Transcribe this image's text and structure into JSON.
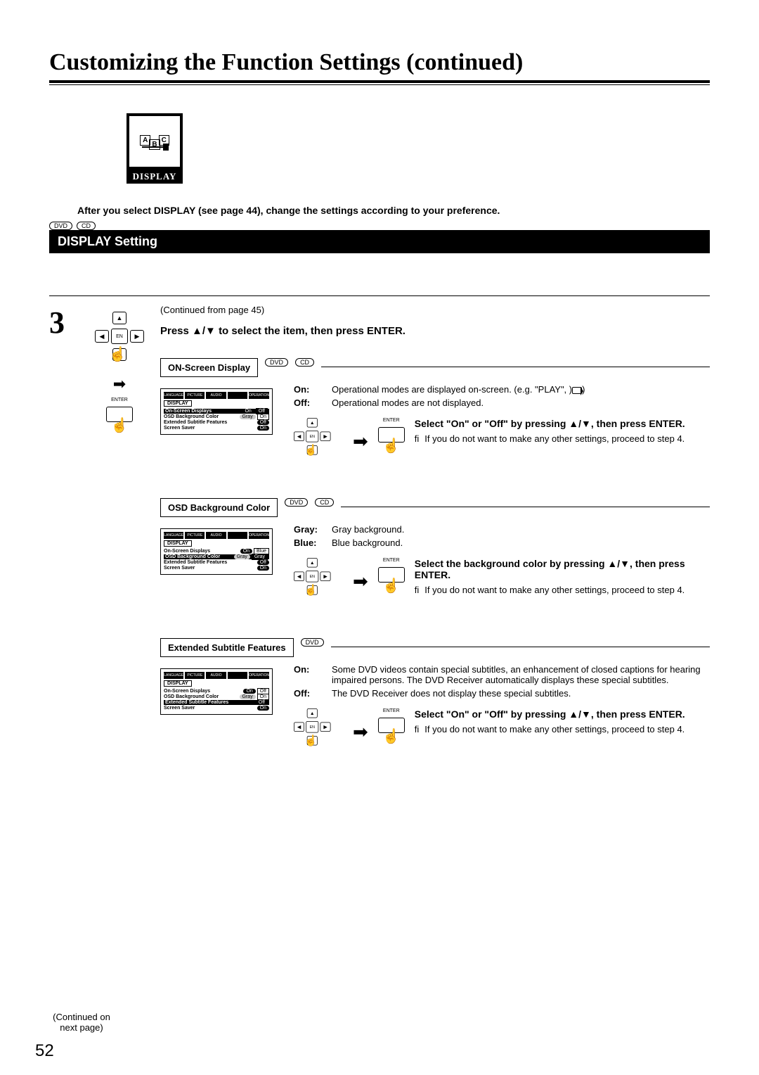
{
  "heading": "Customizing the Function Settings (continued)",
  "display_icon_label": "DISPLAY",
  "intro": "After you select DISPLAY (see page 44), change the settings according to your preference.",
  "disc_dvd": "DVD",
  "disc_cd": "CD",
  "section_bar": "DISPLAY Setting",
  "step_number": "3",
  "continued_from": "(Continued from page 45)",
  "press_instr": "Press ▲/▼ to select the item, then press ENTER.",
  "enter_label": "ENTER",
  "options": {
    "osd": {
      "label": "ON-Screen Display",
      "discs": [
        "DVD",
        "CD"
      ],
      "desc": {
        "on_k": "On:",
        "on_v": "Operational modes are displayed on-screen. (e.g. \"PLAY\",       )",
        "off_k": "Off:",
        "off_v": "Operational modes are not displayed."
      },
      "action_b": "Select \"On\" or \"Off\" by pressing ▲/▼, then press ENTER.",
      "action_note": "If you do not want to make any other settings, proceed to step 4.",
      "preview": {
        "title": "DISPLAY",
        "rows": [
          {
            "lbl": "On-Screen Displays",
            "v1": "On",
            "v2": "Off",
            "hl": true
          },
          {
            "lbl": "OSD Background Color",
            "v1": "Gray",
            "v2": "On"
          },
          {
            "lbl": "Extended Subtitle Features",
            "v1": "Off"
          },
          {
            "lbl": "Screen Saver",
            "v1": "On"
          }
        ]
      }
    },
    "bg": {
      "label": "OSD Background Color",
      "discs": [
        "DVD",
        "CD"
      ],
      "desc": {
        "gray_k": "Gray:",
        "gray_v": "Gray background.",
        "blue_k": "Blue:",
        "blue_v": "Blue background."
      },
      "action_b": "Select the background color by pressing ▲/▼, then press ENTER.",
      "action_note": "If you do not want to make any other settings, proceed to step 4.",
      "preview": {
        "title": "DISPLAY",
        "rows": [
          {
            "lbl": "On-Screen Displays",
            "v1": "On",
            "v2": "Blue"
          },
          {
            "lbl": "OSD Background Color",
            "v1": "Gray",
            "v2": "Gray",
            "hl": true
          },
          {
            "lbl": "Extended Subtitle Features",
            "v1": "Off"
          },
          {
            "lbl": "Screen Saver",
            "v1": "On"
          }
        ]
      }
    },
    "ext": {
      "label": "Extended Subtitle Features",
      "discs": [
        "DVD"
      ],
      "desc": {
        "on_k": "On:",
        "on_v": "Some DVD videos contain special subtitles, an enhancement of closed captions for hearing impaired persons. The DVD Receiver automatically displays these special subtitles.",
        "off_k": "Off:",
        "off_v": "The DVD Receiver does not display these special subtitles."
      },
      "action_b": "Select \"On\" or \"Off\" by pressing ▲/▼, then press ENTER.",
      "action_note": "If you do not want to make any other settings, proceed to step 4.",
      "preview": {
        "title": "DISPLAY",
        "rows": [
          {
            "lbl": "On-Screen Displays",
            "v1": "On",
            "v2": "Off"
          },
          {
            "lbl": "OSD Background Color",
            "v1": "Gray",
            "v2": "On"
          },
          {
            "lbl": "Extended Subtitle Features",
            "v1": "Off",
            "hl": true
          },
          {
            "lbl": "Screen Saver",
            "v1": "On"
          }
        ]
      }
    }
  },
  "note_bullet": "fi",
  "continued_next": "(Continued on next page)",
  "page_number": "52",
  "tab_labels": [
    "LANGUAGE",
    "PICTURE",
    "AUDIO",
    "",
    "OPERATION"
  ]
}
